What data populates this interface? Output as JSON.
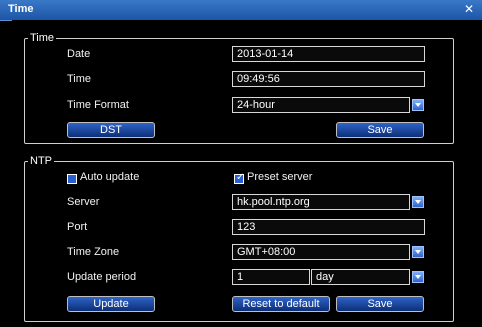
{
  "window": {
    "title": "Time"
  },
  "time": {
    "legend": "Time",
    "date_label": "Date",
    "date_value": "2013-01-14",
    "time_label": "Time",
    "time_value": "09:49:56",
    "format_label": "Time Format",
    "format_value": "24-hour",
    "dst_button": "DST",
    "save_button": "Save"
  },
  "ntp": {
    "legend": "NTP",
    "auto_update_label": "Auto update",
    "auto_update_checked": false,
    "preset_server_label": "Preset server",
    "preset_server_checked": true,
    "server_label": "Server",
    "server_value": "hk.pool.ntp.org",
    "port_label": "Port",
    "port_value": "123",
    "timezone_label": "Time Zone",
    "timezone_value": "GMT+08:00",
    "update_period_label": "Update period",
    "update_period_value": "1",
    "update_period_unit": "day",
    "update_button": "Update",
    "reset_button": "Reset to default",
    "save_button": "Save"
  },
  "icons": {
    "close": "close-icon",
    "dropdown": "chevron-down-icon",
    "checkbox": "checkbox-icon"
  },
  "colors": {
    "titlebar": "#1d55a6",
    "background": "#000000",
    "button": "#0b2f78"
  }
}
